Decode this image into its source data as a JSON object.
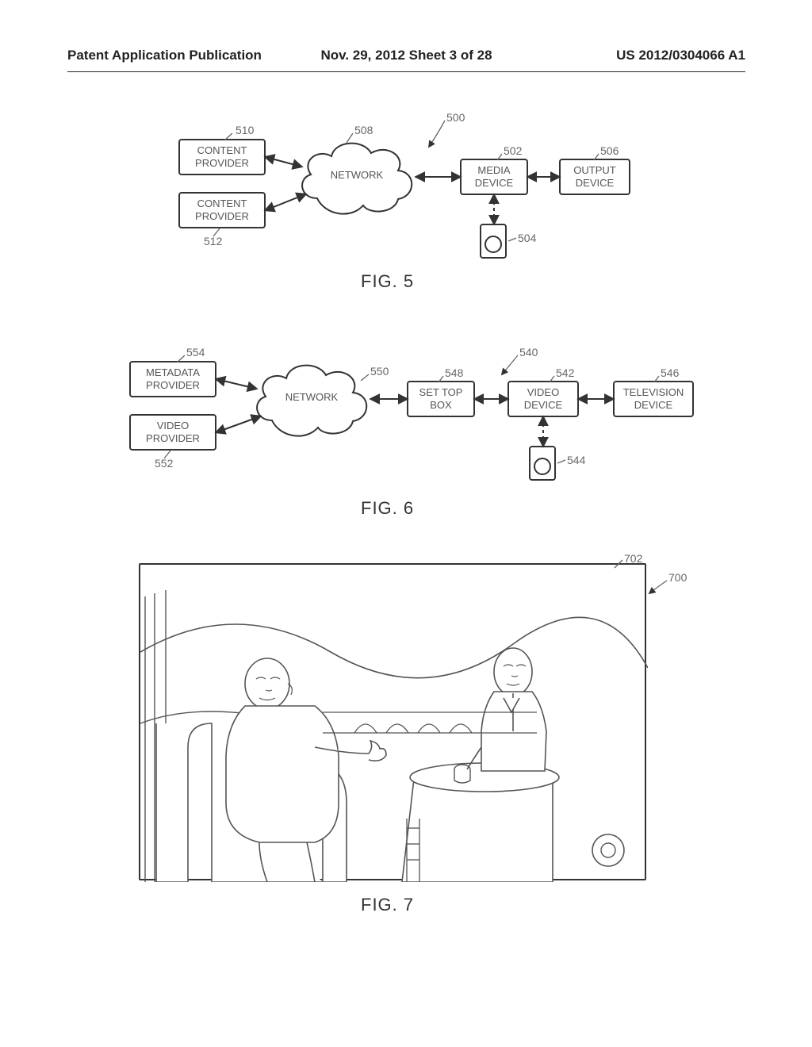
{
  "header": {
    "left": "Patent Application Publication",
    "center": "Nov. 29, 2012  Sheet 3 of 28",
    "right": "US 2012/0304066 A1"
  },
  "fig5": {
    "caption": "FIG. 5",
    "network": "NETWORK",
    "boxes": {
      "content_provider_1": "CONTENT PROVIDER",
      "content_provider_2": "CONTENT PROVIDER",
      "media_device": "MEDIA DEVICE",
      "output_device": "OUTPUT DEVICE"
    },
    "refs": {
      "r500": "500",
      "r502": "502",
      "r504": "504",
      "r506": "506",
      "r508": "508",
      "r510": "510",
      "r512": "512"
    }
  },
  "fig6": {
    "caption": "FIG. 6",
    "network": "NETWORK",
    "boxes": {
      "metadata_provider": "METADATA PROVIDER",
      "video_provider": "VIDEO PROVIDER",
      "set_top_box": "SET TOP BOX",
      "video_device": "VIDEO DEVICE",
      "television_device": "TELEVISION DEVICE"
    },
    "refs": {
      "r540": "540",
      "r542": "542",
      "r544": "544",
      "r546": "546",
      "r548": "548",
      "r550": "550",
      "r552": "552",
      "r554": "554"
    }
  },
  "fig7": {
    "caption": "FIG. 7",
    "refs": {
      "r700": "700",
      "r702": "702"
    }
  }
}
